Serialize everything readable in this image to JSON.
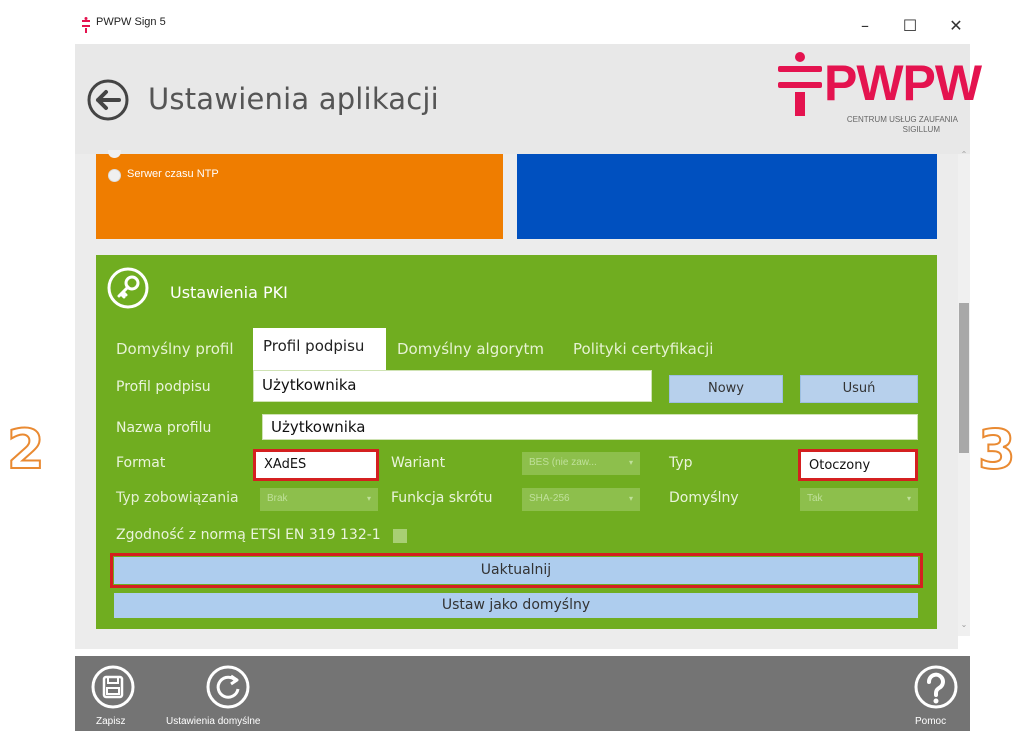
{
  "window": {
    "title": "PWPW Sign 5",
    "minimize": "–",
    "maximize": "☐",
    "close": "✕"
  },
  "header": {
    "title": "Ustawienia aplikacji",
    "logo_text": "PWPW",
    "logo_tagline_1": "CENTRUM USŁUG ZAUFANIA",
    "logo_tagline_2": "SIGILLUM"
  },
  "time_section": {
    "radio_label": "Serwer czasu NTP"
  },
  "pki": {
    "title": "Ustawienia PKI",
    "tabs": [
      {
        "label": "Domyślny profil",
        "active": false
      },
      {
        "label": "Profil podpisu",
        "active": true
      },
      {
        "label": "Domyślny algorytm",
        "active": false
      },
      {
        "label": "Polityki certyfikacji",
        "active": false
      }
    ],
    "profile_label": "Profil podpisu",
    "profile_value": "Użytkownika",
    "new_button": "Nowy",
    "delete_button": "Usuń",
    "name_label": "Nazwa profilu",
    "name_value": "Użytkownika",
    "format_label": "Format",
    "format_value": "XAdES",
    "variant_label": "Wariant",
    "variant_value": "BES (nie zaw...",
    "type_label": "Typ",
    "type_value": "Otoczony",
    "commitment_label": "Typ zobowiązania",
    "commitment_value": "Brak",
    "hash_label": "Funkcja skrótu",
    "hash_value": "SHA-256",
    "default_label": "Domyślny",
    "default_value": "Tak",
    "etsi_label": "Zgodność z normą ETSI EN 319 132-1",
    "update_button": "Uaktualnij",
    "set_default_button": "Ustaw jako domyślny"
  },
  "bottom_bar": {
    "save_label": "Zapisz",
    "defaults_label": "Ustawienia domyślne",
    "help_label": "Pomoc"
  },
  "annotations": {
    "left_number": "2",
    "right_number": "3"
  },
  "colors": {
    "orange_tile": "#ef7d00",
    "blue_tile": "#0050bf",
    "green_panel": "#70ad20",
    "brand_red": "#e4134f",
    "highlight_red": "#d42020",
    "annotation_orange": "#e98a32"
  }
}
